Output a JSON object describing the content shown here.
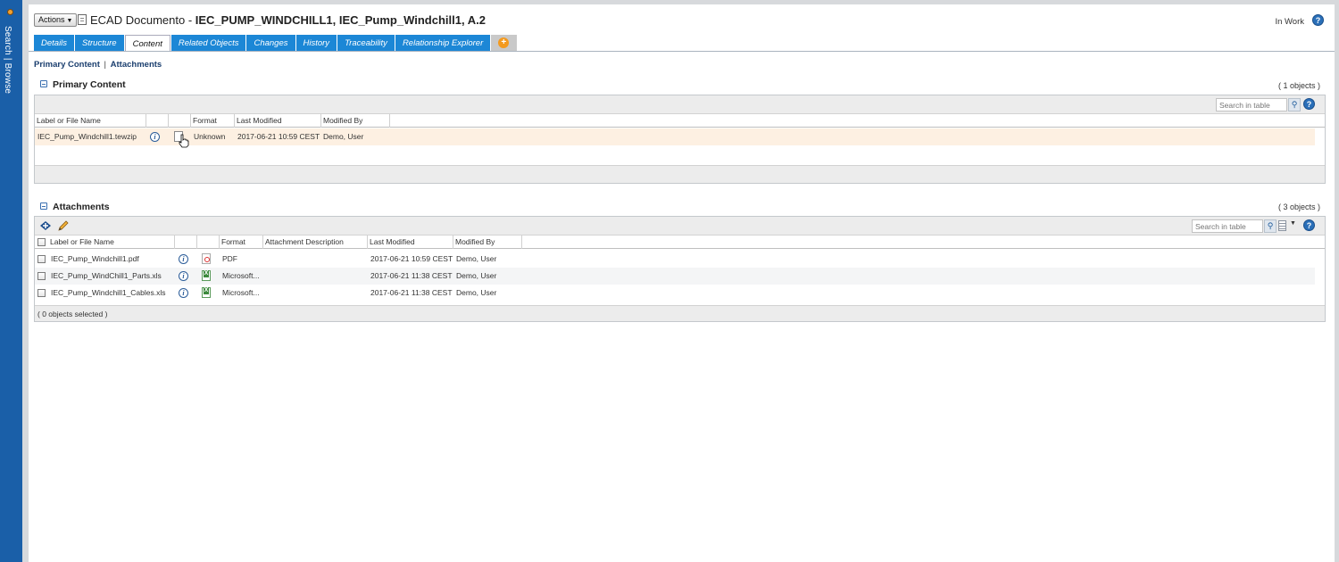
{
  "left_nav": {
    "label": "Search | Browse"
  },
  "header": {
    "actions_label": "Actions",
    "title_prefix": "ECAD Documento - ",
    "title_bold": "IEC_PUMP_WINDCHILL1, IEC_Pump_Windchill1, A.2",
    "status": "In Work",
    "help": "?"
  },
  "tabs": [
    "Details",
    "Structure",
    "Content",
    "Related Objects",
    "Changes",
    "History",
    "Traceability",
    "Relationship Explorer"
  ],
  "active_tab": "Content",
  "sub_links": {
    "primary": "Primary Content",
    "separator": "|",
    "attachments": "Attachments"
  },
  "primary_content": {
    "title": "Primary Content",
    "count": "( 1 objects )",
    "search_placeholder": "Search in table",
    "columns": [
      "Label or File Name",
      "",
      "",
      "Format",
      "Last Modified",
      "Modified By"
    ],
    "rows": [
      {
        "name": "IEC_Pump_Windchill1.tewzip",
        "format": "Unknown",
        "modified": "2017-06-21 10:59 CEST",
        "by": "Demo, User"
      }
    ]
  },
  "attachments": {
    "title": "Attachments",
    "count": "( 3 objects )",
    "search_placeholder": "Search in table",
    "columns": [
      "Label or File Name",
      "",
      "",
      "Format",
      "Attachment Description",
      "Last Modified",
      "Modified By"
    ],
    "rows": [
      {
        "name": "IEC_Pump_Windchill1.pdf",
        "file_type": "pdf",
        "format": "PDF",
        "description": "",
        "modified": "2017-06-21 10:59 CEST",
        "by": "Demo, User"
      },
      {
        "name": "IEC_Pump_WindChill1_Parts.xls",
        "file_type": "xls",
        "format": "Microsoft...",
        "description": "",
        "modified": "2017-06-21 11:38 CEST",
        "by": "Demo, User"
      },
      {
        "name": "IEC_Pump_Windchill1_Cables.xls",
        "file_type": "xls",
        "format": "Microsoft...",
        "description": "",
        "modified": "2017-06-21 11:38 CEST",
        "by": "Demo, User"
      }
    ],
    "selection_status": "( 0 objects selected )"
  },
  "colors": {
    "tab_blue": "#1c87d6",
    "nav_blue": "#1a5fa8",
    "highlight_row": "#fdf0e2",
    "link": "#1a4a86"
  }
}
